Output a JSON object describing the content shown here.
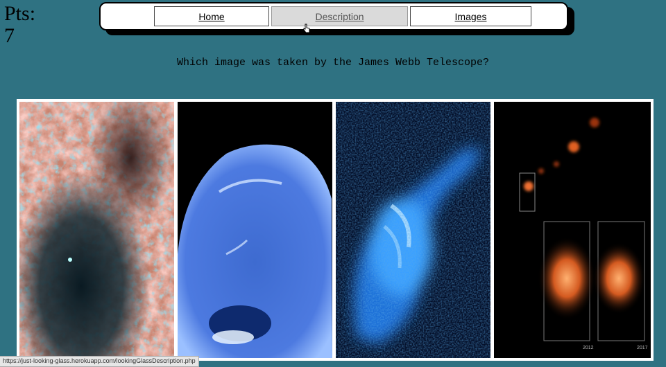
{
  "score": {
    "label": "Pts:",
    "value": "7"
  },
  "nav": {
    "home": "Home",
    "description": "Description",
    "images": "Images"
  },
  "question": "Which image was taken by the James Webb Telescope?",
  "images": [
    {
      "name": "nebula-image"
    },
    {
      "name": "neptune-image"
    },
    {
      "name": "pulsar-image"
    },
    {
      "name": "supernova-image",
      "labels": [
        "2012",
        "2017"
      ]
    }
  ],
  "status_url": "https://just-looking-glass.herokuapp.com/lookingGlassDescription.php"
}
